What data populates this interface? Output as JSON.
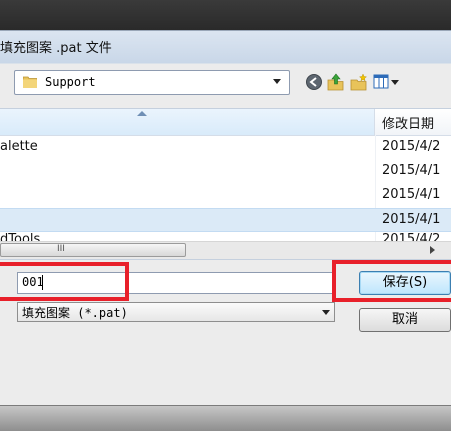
{
  "dialog": {
    "title": "填充图案 .pat 文件"
  },
  "location": {
    "folder": "Support",
    "icons": [
      "folder-icon",
      "back-icon",
      "up-folder-icon",
      "new-folder-icon",
      "view-menu-icon"
    ]
  },
  "file_list": {
    "columns": {
      "name": "",
      "date_modified": "修改日期"
    },
    "rows": [
      {
        "name": "alette",
        "date": "2015/4/2",
        "selected": false
      },
      {
        "name": "",
        "date": "2015/4/1",
        "selected": false
      },
      {
        "name": "",
        "date": "2015/4/1",
        "selected": false
      },
      {
        "name": "",
        "date": "2015/4/1",
        "selected": true
      },
      {
        "name": "dTools",
        "date": "2015/4/2",
        "selected": false
      }
    ],
    "scrollbar_grip": "III"
  },
  "form": {
    "filename_value": "001",
    "filetype_value": "填充图案 (*.pat)"
  },
  "buttons": {
    "save": "保存(S)",
    "cancel": "取消"
  },
  "colors": {
    "highlight": "#e8202a",
    "selection": "#dbeaf7"
  }
}
